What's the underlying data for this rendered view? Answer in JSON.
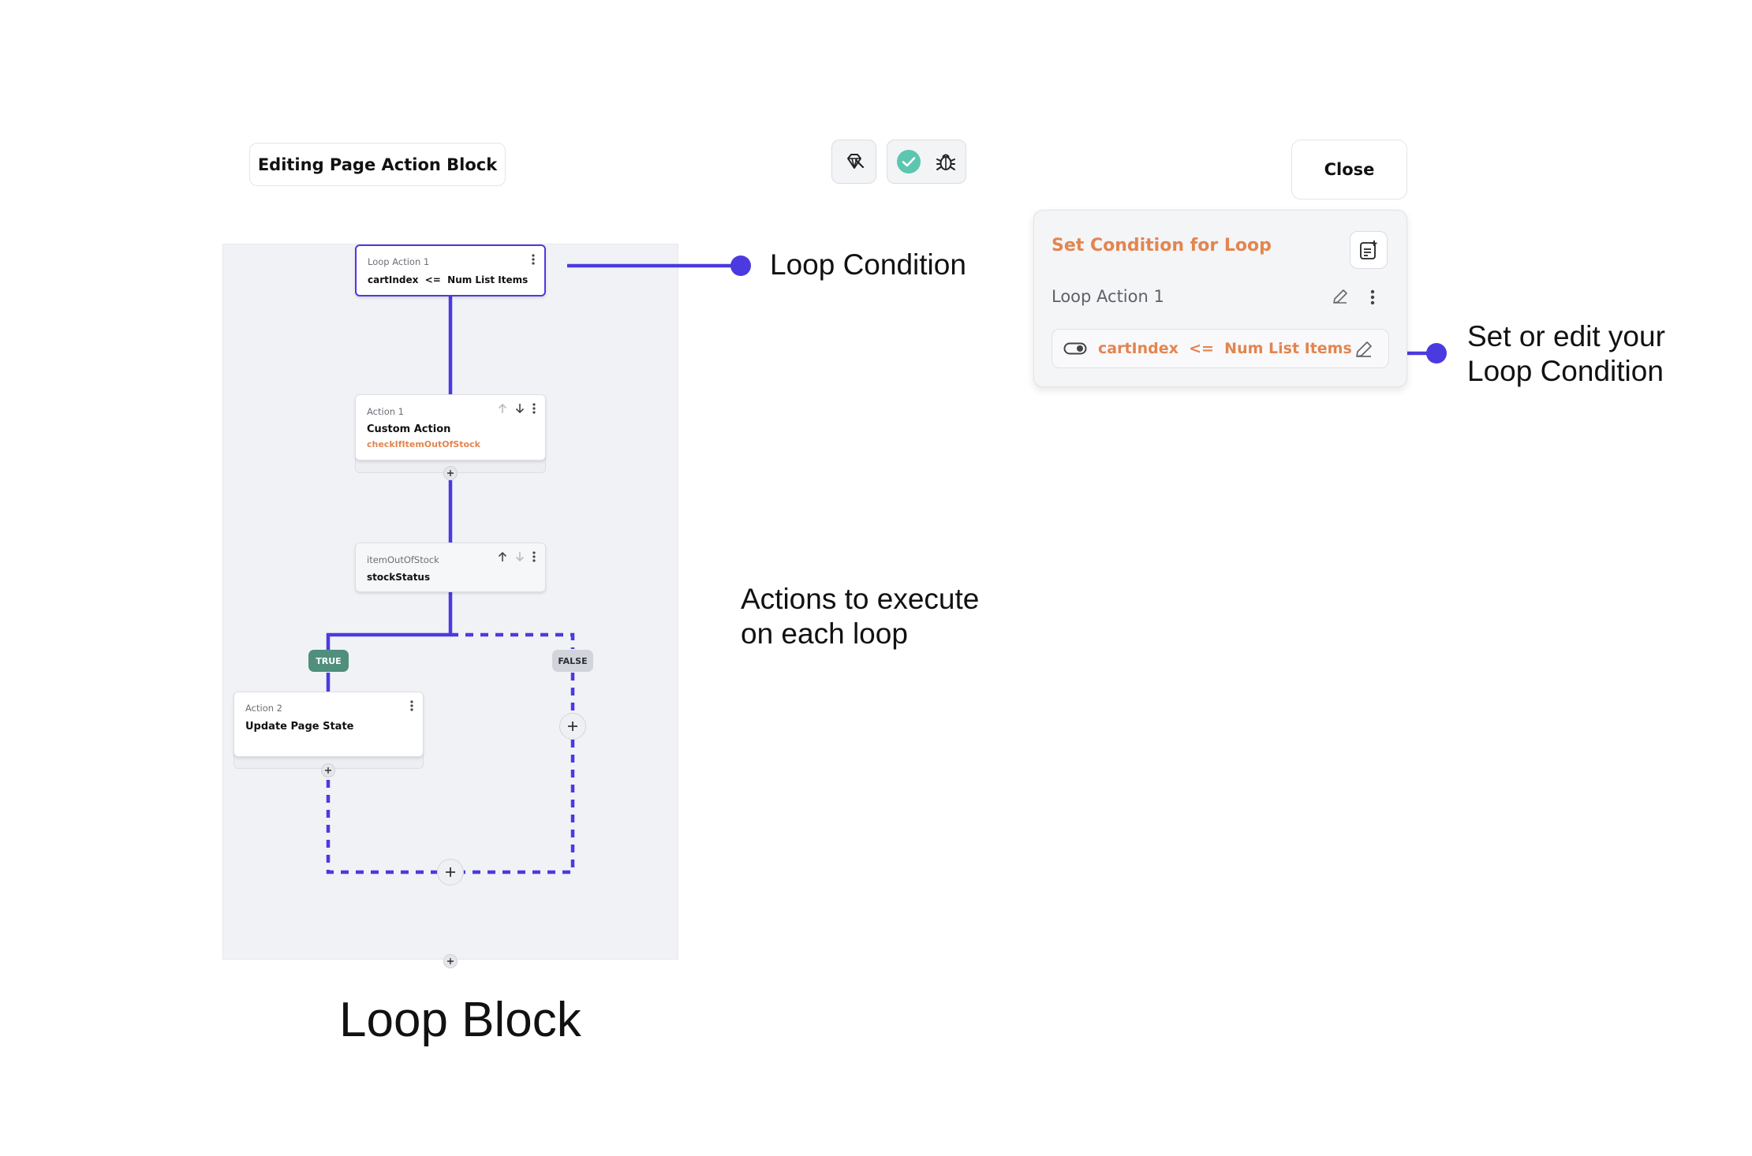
{
  "header": {
    "title": "Editing Page Action Block",
    "close_label": "Close"
  },
  "colors": {
    "accent_line": "#4b3ae0",
    "orange": "#e3854f",
    "true_badge": "#4f8f7c",
    "false_badge": "#d1d5db",
    "success_check": "#5cc6b0"
  },
  "icons": [
    "magic-wand-icon",
    "check-circle-icon",
    "bug-icon",
    "document-add-icon",
    "pencil-icon",
    "more-vertical-icon",
    "arrow-up-icon",
    "arrow-down-icon",
    "plus-icon",
    "toggle-icon"
  ],
  "flow": {
    "loop_node": {
      "label": "Loop Action 1",
      "condition": "cartIndex  <=  Num List Items"
    },
    "action1": {
      "label": "Action 1",
      "title": "Custom Action",
      "subtitle": "checkIfItemOutOfStock"
    },
    "conditional": {
      "label": "itemOutOfStock",
      "title": "stockStatus"
    },
    "true_badge": "TRUE",
    "false_badge": "FALSE",
    "action2": {
      "label": "Action 2",
      "title": "Update Page State"
    }
  },
  "annotations": {
    "loop_condition": "Loop Condition",
    "actions_line1": "Actions to execute",
    "actions_line2": "on each loop",
    "set_edit_line1": "Set or edit your",
    "set_edit_line2": "Loop Condition",
    "loop_block": "Loop Block"
  },
  "panel": {
    "title": "Set Condition for Loop",
    "loop_label": "Loop Action 1",
    "condition": "cartIndex  <=  Num List Items"
  }
}
